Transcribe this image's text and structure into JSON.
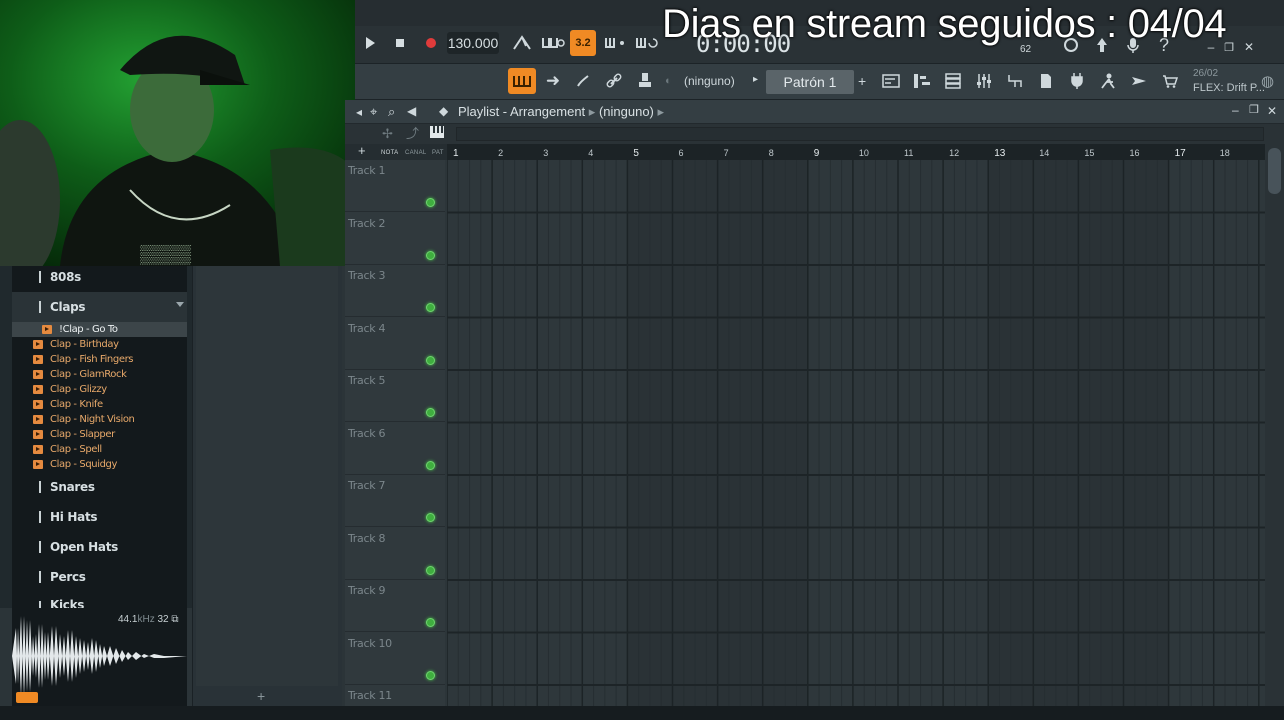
{
  "overlay": {
    "stream_text": "Dias en stream seguidos : 04/04"
  },
  "transport": {
    "tempo": "130.000",
    "time": "0:00:00",
    "pattern_label": "Patrón 1",
    "pattern_none": "(ninguno)",
    "snap_label": "3.2",
    "cpu": "62"
  },
  "hint": {
    "date": "26/02",
    "text": "FLEX: Drift P..."
  },
  "browser": {
    "folders": [
      {
        "label": "808s"
      },
      {
        "label": "Claps"
      },
      {
        "label": "Snares"
      },
      {
        "label": "Hi Hats"
      },
      {
        "label": "Open Hats"
      },
      {
        "label": "Percs"
      },
      {
        "label": "Kicks"
      }
    ],
    "files": [
      {
        "label": "!Clap - Go To"
      },
      {
        "label": "Clap - Birthday"
      },
      {
        "label": "Clap - Fish Fingers"
      },
      {
        "label": "Clap - GlamRock"
      },
      {
        "label": "Clap - Glizzy"
      },
      {
        "label": "Clap - Knife"
      },
      {
        "label": "Clap - Night Vision"
      },
      {
        "label": "Clap - Slapper"
      },
      {
        "label": "Clap - Spell"
      },
      {
        "label": "Clap - Squidgy"
      }
    ],
    "preview": {
      "rate": "44.1",
      "unit": "kHz",
      "bits": "32"
    }
  },
  "playlist": {
    "title": "Playlist - Arrangement",
    "arrangement": "(ninguno)",
    "ruler_labels": {
      "nota": "NOTA",
      "canal": "CANAL",
      "pat": "PAT"
    },
    "bars": [
      "1",
      "2",
      "3",
      "4",
      "5",
      "6",
      "7",
      "8",
      "9",
      "10",
      "11",
      "12",
      "13",
      "14",
      "15",
      "16",
      "17",
      "18"
    ],
    "tracks": [
      "Track 1",
      "Track 2",
      "Track 3",
      "Track 4",
      "Track 5",
      "Track 6",
      "Track 7",
      "Track 8",
      "Track 9",
      "Track 10",
      "Track 11"
    ]
  },
  "colors": {
    "accent": "#f08a24",
    "led": "#3fae3f",
    "file_text": "#e8a96a"
  }
}
